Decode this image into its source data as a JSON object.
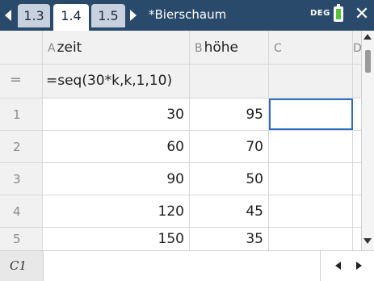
{
  "titlebar": {
    "tabs": [
      "1.3",
      "1.4",
      "1.5"
    ],
    "active_tab": "1.4",
    "document_title": "*Bierschaum",
    "angle_mode": "DEG",
    "battery_color": "#56c23a"
  },
  "spreadsheet": {
    "columns": [
      {
        "letter": "A",
        "name": "zeit"
      },
      {
        "letter": "B",
        "name": "höhe"
      },
      {
        "letter": "C",
        "name": ""
      },
      {
        "letter": "D",
        "name": ""
      }
    ],
    "formula_row": {
      "marker": "=",
      "colA_formula": "=seq(30*k,k,1,10)"
    },
    "rows": [
      {
        "num": "1",
        "a": "30",
        "b": "95"
      },
      {
        "num": "2",
        "a": "60",
        "b": "70"
      },
      {
        "num": "3",
        "a": "90",
        "b": "50"
      },
      {
        "num": "4",
        "a": "120",
        "b": "45"
      },
      {
        "num": "5",
        "a": "150",
        "b": "35"
      }
    ],
    "selected_cell": "C1",
    "selection_color": "#2c6cc4"
  },
  "entrybar": {
    "cell_reference": "C1",
    "content": ""
  },
  "colors": {
    "titlebar_bg": "#2a4a6c",
    "tab_inactive": "#c7d2de",
    "header_bg": "#f1f1f1"
  }
}
